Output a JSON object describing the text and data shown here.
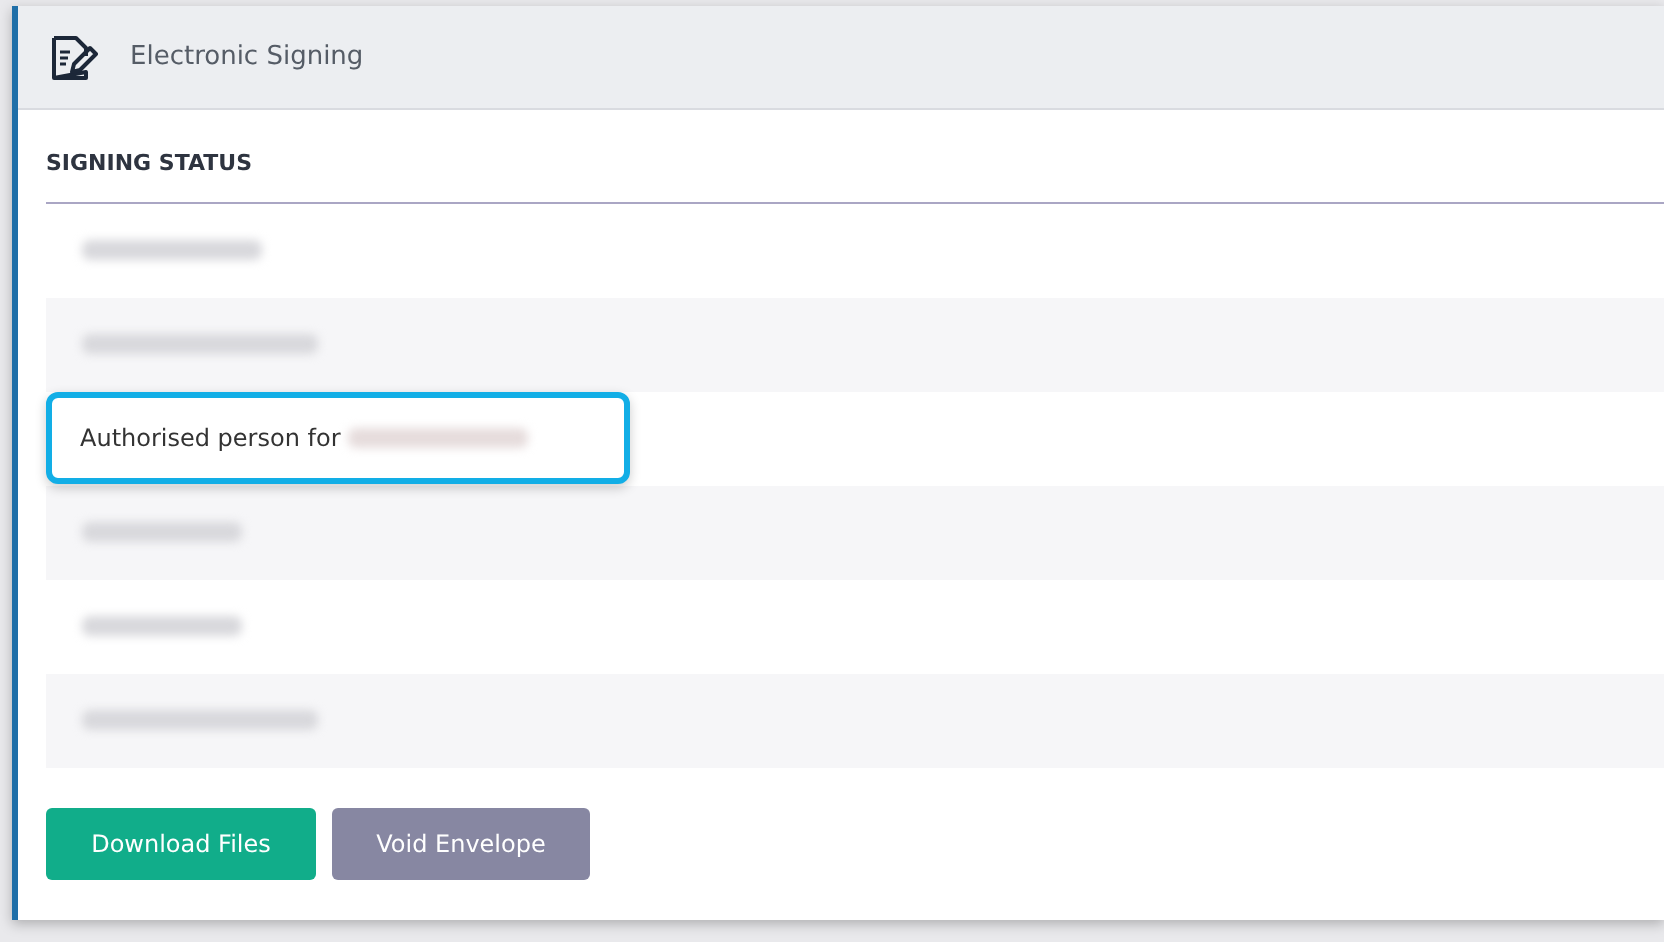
{
  "header": {
    "title": "Electronic Signing"
  },
  "section": {
    "title": "SIGNING STATUS"
  },
  "rows": [
    {
      "kind": "redacted",
      "highlighted": false
    },
    {
      "kind": "redacted",
      "highlighted": false
    },
    {
      "kind": "text",
      "label": "Authorised person for",
      "redacted_suffix": true,
      "highlighted": true
    },
    {
      "kind": "redacted",
      "highlighted": false
    },
    {
      "kind": "redacted",
      "highlighted": false
    },
    {
      "kind": "redacted",
      "highlighted": false
    }
  ],
  "buttons": [
    {
      "label": "Download Files",
      "kind": "primary"
    },
    {
      "label": "Void Envelope",
      "kind": "secondary"
    }
  ]
}
